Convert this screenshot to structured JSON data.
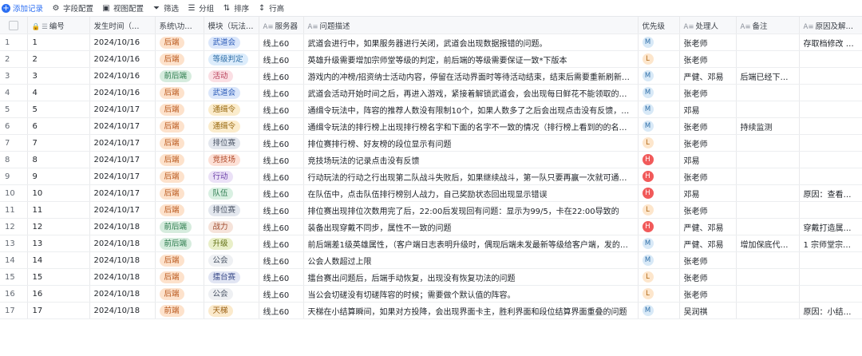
{
  "toolbar": {
    "add": "添加记录",
    "field_config": "字段配置",
    "view_config": "视图配置",
    "filter": "筛选",
    "group": "分组",
    "sort": "排序",
    "row_height": "行高"
  },
  "columns": {
    "id": "编号",
    "time": "发生时间（…",
    "system": "系统\\功能…",
    "module": "模块（玩法…",
    "server": "服务器",
    "desc": "问题描述",
    "priority": "优先级",
    "handler": "处理人",
    "note": "备注",
    "reason": "原因及解决方式"
  },
  "rows": [
    {
      "rn": "1",
      "id": "1",
      "time": "2024/10/16",
      "system": "后端",
      "module": "武道会",
      "server": "线上60",
      "desc": "武道会进行中，如果服务器进行关闭，武道会出现数据报错的问题。",
      "priority": "M",
      "handler": "张老师",
      "note": "",
      "reason": "存取档修改 20和…"
    },
    {
      "rn": "2",
      "id": "2",
      "time": "2024/10/16",
      "system": "后端",
      "module": "等级判定",
      "server": "线上60",
      "desc": "英雄升级需要增加宗师堂等级的判定，前后端的等级需要保证一致*下版本",
      "priority": "L",
      "handler": "张老师",
      "note": "",
      "reason": ""
    },
    {
      "rn": "3",
      "id": "3",
      "time": "2024/10/16",
      "system": "前后端",
      "module": "活动",
      "server": "线上60",
      "desc": "游戏内的冲榜/招资纳士活动内容，停留在活动界面时等待活动结束，结束后需要重新刷新才会最终…",
      "priority": "M",
      "handler": "严健、邓易",
      "note": "后端已经下发…",
      "reason": ""
    },
    {
      "rn": "4",
      "id": "4",
      "time": "2024/10/16",
      "system": "后端",
      "module": "武道会",
      "server": "线上60",
      "desc": "武道会活动开始时间之后，再进入游戏，紧接着解锁武道会，会出现每日鲜花不能领取的问题",
      "priority": "M",
      "handler": "张老师",
      "note": "",
      "reason": ""
    },
    {
      "rn": "5",
      "id": "5",
      "time": "2024/10/17",
      "system": "后端",
      "module": "通缉令",
      "server": "线上60",
      "desc": "通缉令玩法中，阵容的推荐人数没有限制10个，如果人数多了之后会出现点击没有反馈，不回包的…",
      "priority": "M",
      "handler": "邓易",
      "note": "",
      "reason": ""
    },
    {
      "rn": "6",
      "id": "6",
      "time": "2024/10/17",
      "system": "后端",
      "module": "通缉令",
      "server": "线上60",
      "desc": "通缉令玩法的排行榜上出现排行榜名字和下面的名字不一致的情况（排行榜上看到的的名字，两个伤…",
      "priority": "M",
      "handler": "张老师",
      "note": "持续监测",
      "reason": ""
    },
    {
      "rn": "7",
      "id": "7",
      "time": "2024/10/17",
      "system": "后端",
      "module": "排位赛",
      "server": "线上60",
      "desc": "排位赛排行榜、好友榜的段位显示有问题",
      "priority": "L",
      "handler": "张老师",
      "note": "",
      "reason": ""
    },
    {
      "rn": "8",
      "id": "8",
      "time": "2024/10/17",
      "system": "后端",
      "module": "竞技场",
      "server": "线上60",
      "desc": "竞技场玩法的记录点击没有反馈",
      "priority": "H",
      "handler": "邓易",
      "note": "",
      "reason": ""
    },
    {
      "rn": "9",
      "id": "9",
      "time": "2024/10/17",
      "system": "后端",
      "module": "行动",
      "server": "线上60",
      "desc": "行动玩法的行动之行出现第二队战斗失败后，如果继续战斗，第一队只要再赢一次就可通过该层的问…",
      "priority": "H",
      "handler": "张老师",
      "note": "",
      "reason": ""
    },
    {
      "rn": "10",
      "id": "10",
      "time": "2024/10/17",
      "system": "后端",
      "module": "队伍",
      "server": "线上60",
      "desc": "在队伍中，点击队伍排行榜别人战力，自己奖励状态回出现显示错误",
      "priority": "H",
      "handler": "邓易",
      "note": "",
      "reason": "原因：查看他人名…"
    },
    {
      "rn": "11",
      "id": "11",
      "time": "2024/10/17",
      "system": "后端",
      "module": "排位赛",
      "server": "线上60",
      "desc": "排位赛出现排位次数用完了后，22:00后发现回有问题：显示为99/5，卡在22:00导致的",
      "priority": "L",
      "handler": "张老师",
      "note": "",
      "reason": ""
    },
    {
      "rn": "12",
      "id": "12",
      "time": "2024/10/18",
      "system": "前后端",
      "module": "战力",
      "server": "线上60",
      "desc": "装备出现穿戴不同步，属性不一致的问题",
      "priority": "H",
      "handler": "严健、邓易",
      "note": "",
      "reason": "穿戴打造属性用的…"
    },
    {
      "rn": "13",
      "id": "13",
      "time": "2024/10/18",
      "system": "前后端",
      "module": "升级",
      "server": "线上60",
      "desc": "前后端差1级英雄属性，（客户端日志表明升级时，偶现后端未发最新等级给客户端，发的是同一级）",
      "priority": "M",
      "handler": "严健、邓易",
      "note": "增加保底代码…",
      "reason": "1 宗师堂宗师的权…"
    },
    {
      "rn": "14",
      "id": "14",
      "time": "2024/10/18",
      "system": "后端",
      "module": "公会",
      "server": "线上60",
      "desc": "公会人数超过上限",
      "priority": "M",
      "handler": "张老师",
      "note": "",
      "reason": ""
    },
    {
      "rn": "15",
      "id": "15",
      "time": "2024/10/18",
      "system": "后端",
      "module": "擂台赛",
      "server": "线上60",
      "desc": "擂台赛出问题后，后端手动恢复，出现没有恢复功法的问题",
      "priority": "L",
      "handler": "张老师",
      "note": "",
      "reason": ""
    },
    {
      "rn": "16",
      "id": "16",
      "time": "2024/10/18",
      "system": "后端",
      "module": "公会",
      "server": "线上60",
      "desc": "当公会切磋没有切磋阵容的时候；需要做个默认值的阵容。",
      "priority": "L",
      "handler": "张老师",
      "note": "",
      "reason": ""
    },
    {
      "rn": "17",
      "id": "17",
      "time": "2024/10/18",
      "system": "前端",
      "module": "天梯",
      "server": "线上60",
      "desc": "天梯在小结算瞬间，如果对方投降，会出现界面卡主，胜利界面和段位结算界面重叠的问题",
      "priority": "M",
      "handler": "吴润祺",
      "note": "",
      "reason": "原因：小结算弹窗…"
    }
  ]
}
